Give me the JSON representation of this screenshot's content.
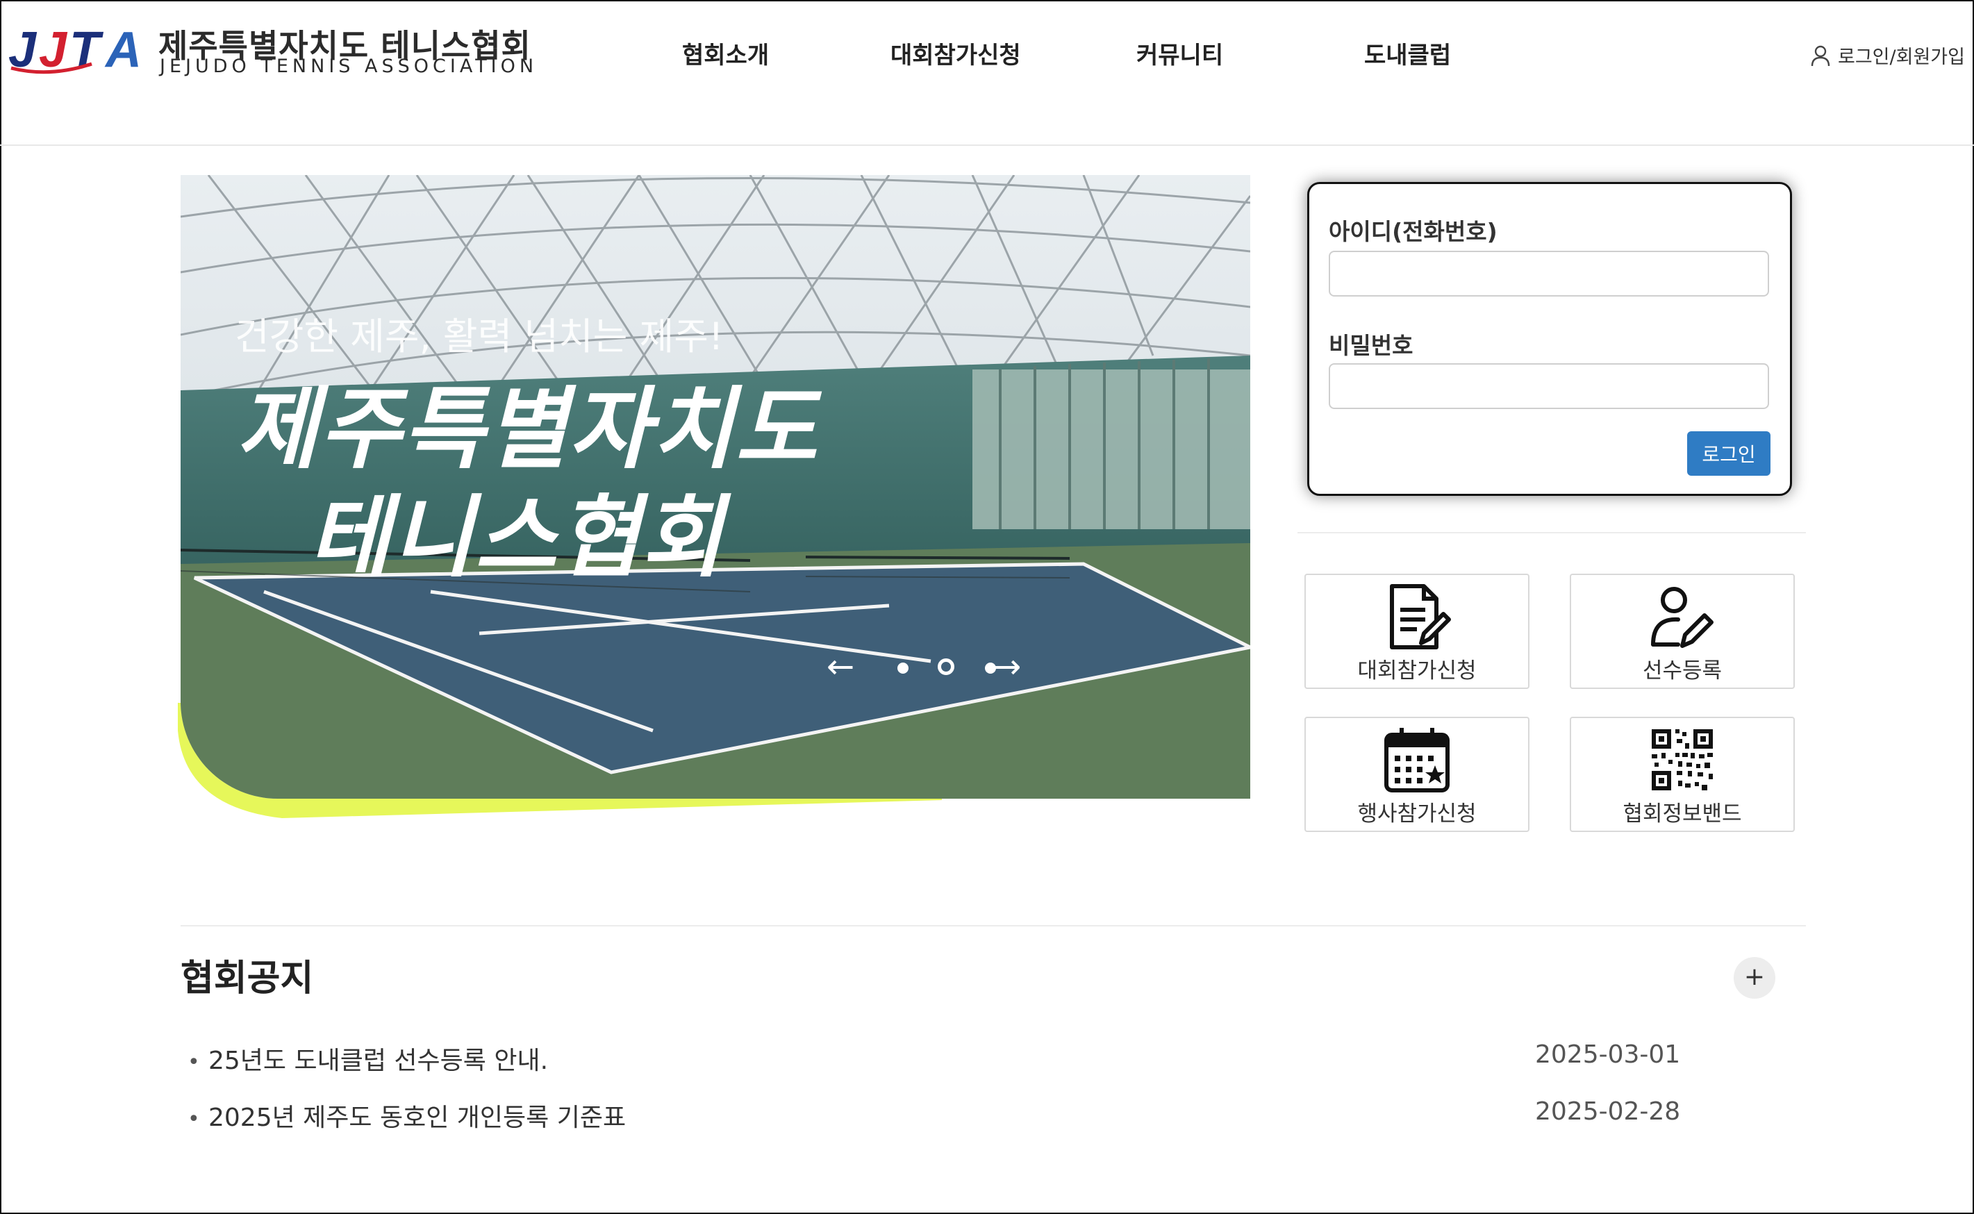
{
  "brand": {
    "mark": "JJTA",
    "name_ko": "제주특별자치도 테니스협회",
    "name_en": "JEJUDO TENNIS ASSOCIATION",
    "colors": {
      "navy": "#1b2f7a",
      "red": "#d3202f",
      "blue": "#2b63b8"
    }
  },
  "nav": {
    "items": [
      {
        "label": "협회소개"
      },
      {
        "label": "대회참가신청"
      },
      {
        "label": "커뮤니티"
      },
      {
        "label": "도내클럽"
      }
    ],
    "login_signup": "로그인/회원가입",
    "login_icon": "user-icon"
  },
  "hero": {
    "subtitle": "건강한 제주, 활력 넘치는 제주!",
    "title_line1": "제주특별자치도",
    "title_line2": "테니스협회",
    "accent_color": "#e6f75a",
    "carousel": {
      "prev": "←",
      "next": "→",
      "slide_count": 3,
      "active_index": 1
    }
  },
  "login_form": {
    "id_label": "아이디(전화번호)",
    "id_value": "",
    "password_label": "비밀번호",
    "password_value": "",
    "submit_label": "로그인",
    "submit_color": "#2f7cc4"
  },
  "quick_links": [
    {
      "label": "대회참가신청",
      "icon": "document-edit-icon"
    },
    {
      "label": "선수등록",
      "icon": "user-edit-icon"
    },
    {
      "label": "행사참가신청",
      "icon": "calendar-star-icon"
    },
    {
      "label": "협회정보밴드",
      "icon": "qr-code-icon"
    }
  ],
  "notices": {
    "title": "협회공지",
    "more_label": "+",
    "items": [
      {
        "bullet": "•",
        "text": "25년도 도내클럽 선수등록 안내.",
        "date": "2025-03-01"
      },
      {
        "bullet": "•",
        "text": "2025년 제주도 동호인 개인등록 기준표",
        "date": "2025-02-28"
      }
    ]
  }
}
